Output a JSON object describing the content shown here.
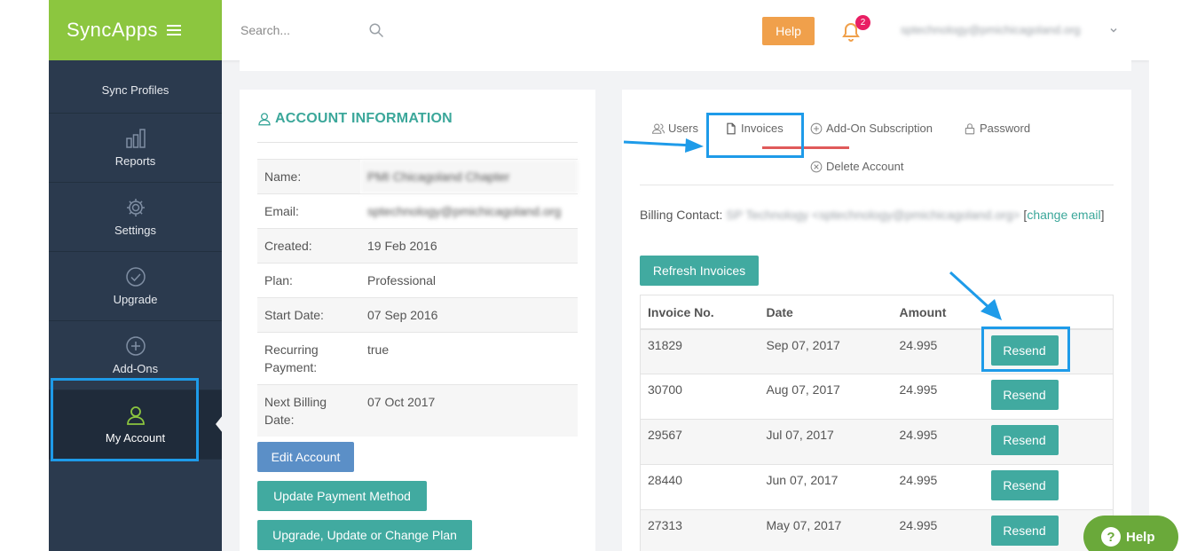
{
  "brand": {
    "name": "SyncApps",
    "accent": "#8cc63f",
    "teal": "#41aaa0",
    "highlight": "#1e9be9"
  },
  "sidebar": {
    "items": [
      {
        "label": "Sync Profiles",
        "icon": "gears-icon"
      },
      {
        "label": "Reports",
        "icon": "bar-chart-icon"
      },
      {
        "label": "Settings",
        "icon": "gear-icon"
      },
      {
        "label": "Upgrade",
        "icon": "check-circle-icon"
      },
      {
        "label": "Add-Ons",
        "icon": "plus-circle-icon"
      },
      {
        "label": "My Account",
        "icon": "user-icon",
        "active": true
      }
    ]
  },
  "header": {
    "search_placeholder": "Search...",
    "help_label": "Help",
    "notification_count": "2",
    "user_email": "sptechnology@pmichicagoland.org"
  },
  "account": {
    "title": "ACCOUNT INFORMATION",
    "rows": [
      {
        "key": "Name:",
        "value": "PMI Chicagoland Chapter",
        "blurred": true
      },
      {
        "key": "Email:",
        "value": "sptechnology@pmichicagoland.org",
        "blurred": true
      },
      {
        "key": "Created:",
        "value": "19 Feb 2016"
      },
      {
        "key": "Plan:",
        "value": "Professional"
      },
      {
        "key": "Start Date:",
        "value": "07 Sep 2016"
      },
      {
        "key": "Recurring Payment:",
        "value": "true"
      },
      {
        "key": "Next Billing Date:",
        "value": "07 Oct 2017"
      }
    ],
    "edit_label": "Edit Account",
    "update_payment_label": "Update Payment Method",
    "upgrade_label": "Upgrade, Update or Change Plan"
  },
  "tabs": {
    "users": "Users",
    "invoices": "Invoices",
    "addon": "Add-On Subscription",
    "password": "Password",
    "delete": "Delete Account"
  },
  "billing": {
    "prefix": "Billing Contact:",
    "contact": "SP Technology <sptechnology@pmichicagoland.org>",
    "change_pre": "[",
    "change_link": "change email",
    "change_post": "]",
    "refresh_label": "Refresh Invoices"
  },
  "invoices": {
    "headers": [
      "Invoice No.",
      "Date",
      "Amount"
    ],
    "rows": [
      {
        "no": "31829",
        "date": "Sep 07, 2017",
        "amount": "24.995"
      },
      {
        "no": "30700",
        "date": "Aug 07, 2017",
        "amount": "24.995"
      },
      {
        "no": "29567",
        "date": "Jul 07, 2017",
        "amount": "24.995"
      },
      {
        "no": "28440",
        "date": "Jun 07, 2017",
        "amount": "24.995"
      },
      {
        "no": "27313",
        "date": "May 07, 2017",
        "amount": "24.995"
      }
    ],
    "resend_label": "Resend"
  },
  "help_float_label": "Help"
}
